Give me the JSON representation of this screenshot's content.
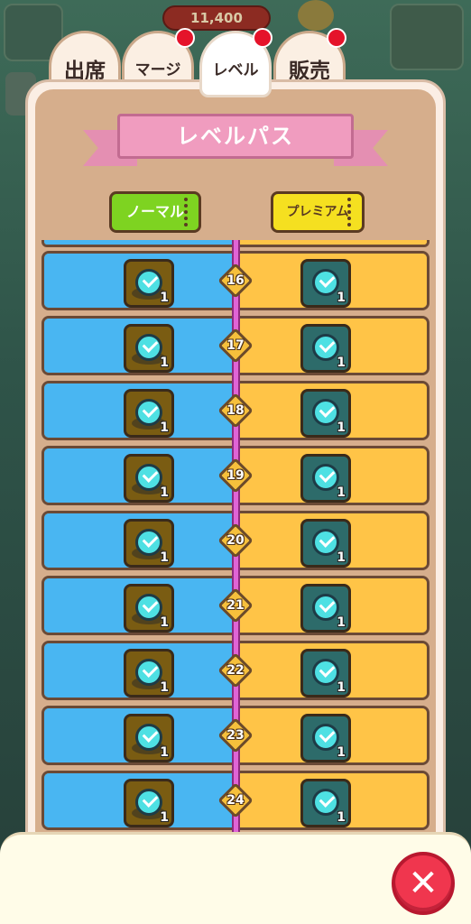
{
  "background": {
    "currency_amount": "11,400"
  },
  "tabs": [
    {
      "label": "出席",
      "active": false,
      "has_notification": false
    },
    {
      "label": "マージ",
      "active": false,
      "has_notification": true
    },
    {
      "label": "レベル",
      "active": true,
      "has_notification": true
    },
    {
      "label": "販売",
      "active": false,
      "has_notification": true
    }
  ],
  "panel": {
    "title": "レベルパス",
    "normal_ticket": "ノーマル",
    "premium_ticket": "プレミアム"
  },
  "levels": [
    {
      "level": "16",
      "normal_qty": "1",
      "premium_qty": "1"
    },
    {
      "level": "17",
      "normal_qty": "1",
      "premium_qty": "1"
    },
    {
      "level": "18",
      "normal_qty": "1",
      "premium_qty": "1"
    },
    {
      "level": "19",
      "normal_qty": "1",
      "premium_qty": "1"
    },
    {
      "level": "20",
      "normal_qty": "1",
      "premium_qty": "1"
    },
    {
      "level": "21",
      "normal_qty": "1",
      "premium_qty": "1"
    },
    {
      "level": "22",
      "normal_qty": "1",
      "premium_qty": "1"
    },
    {
      "level": "23",
      "normal_qty": "1",
      "premium_qty": "1"
    },
    {
      "level": "24",
      "normal_qty": "1",
      "premium_qty": "1"
    }
  ],
  "close_icon": "close-x-icon",
  "colors": {
    "normal_lane": "#49b6f2",
    "premium_lane": "#ffc447",
    "track": "#e064d6",
    "ribbon": "#f09cbf",
    "close_button": "#f0364e"
  }
}
